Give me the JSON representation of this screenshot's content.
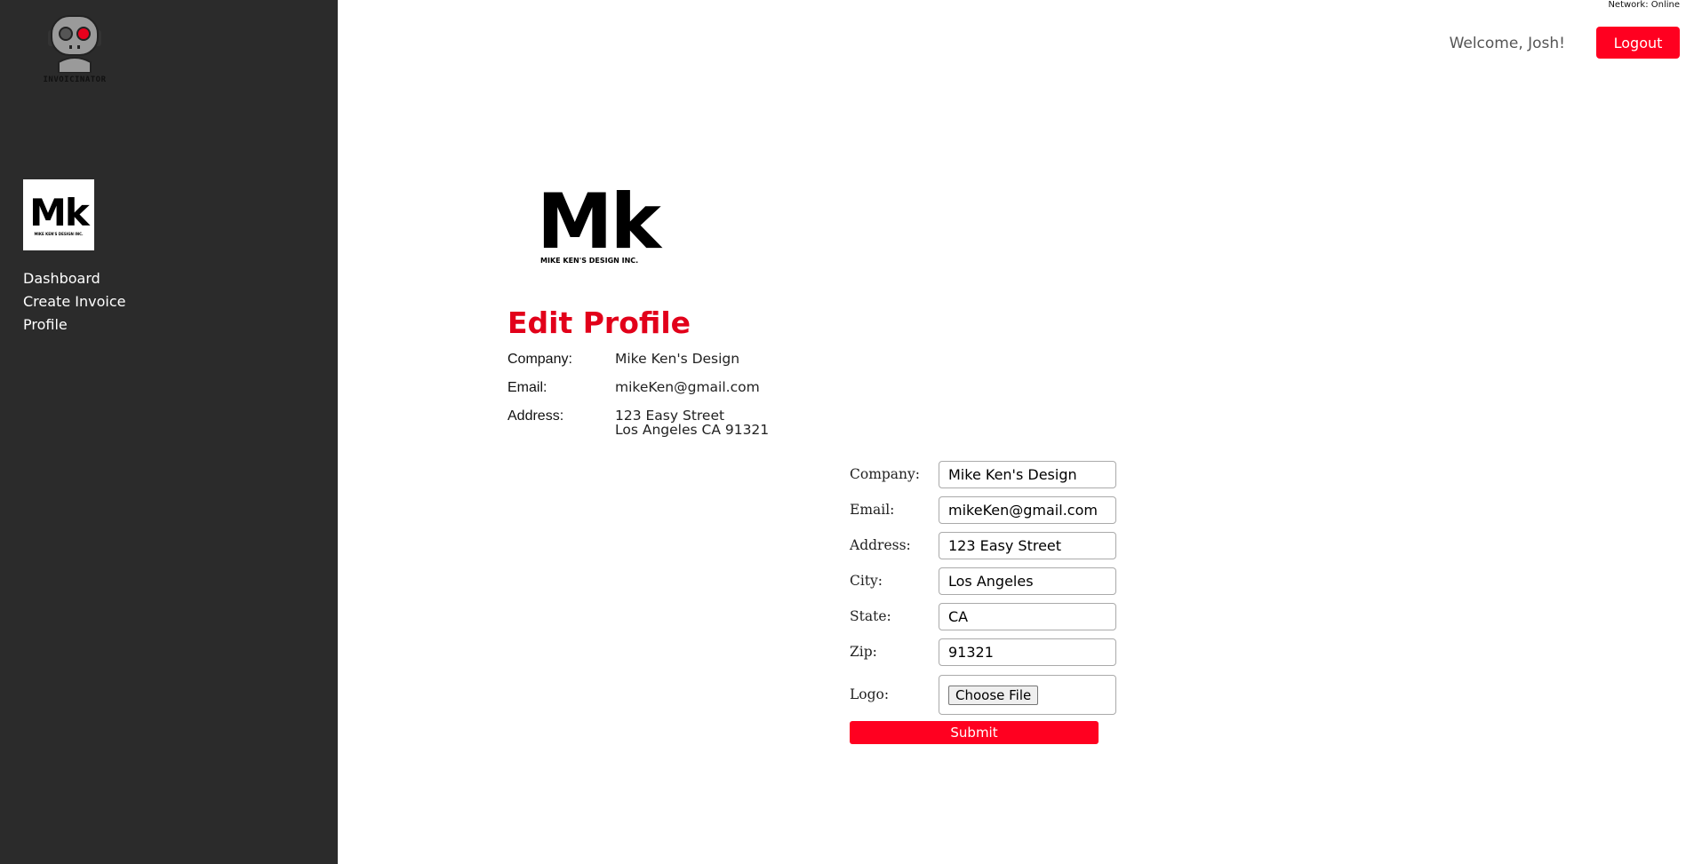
{
  "app": {
    "name": "INVOICINATOR"
  },
  "header": {
    "network_status": "Network: Online",
    "welcome": "Welcome, Josh!",
    "logout_label": "Logout"
  },
  "company_logo": {
    "initials": "Mk",
    "tagline": "MIKE KEN'S DESIGN INC."
  },
  "sidebar": {
    "items": [
      {
        "label": "Dashboard"
      },
      {
        "label": "Create Invoice"
      },
      {
        "label": "Profile"
      }
    ]
  },
  "profile": {
    "title": "Edit Profile",
    "company_label": "Company:",
    "company": "Mike Ken's Design",
    "email_label": "Email:",
    "email": "mikeKen@gmail.com",
    "address_label": "Address:",
    "address_line1": "123 Easy Street",
    "address_line2": "Los Angeles CA 91321"
  },
  "form": {
    "company_label": "Company:",
    "company_value": "Mike Ken's Design",
    "email_label": "Email:",
    "email_value": "mikeKen@gmail.com",
    "address_label": "Address:",
    "address_value": "123 Easy Street",
    "city_label": "City:",
    "city_value": "Los Angeles",
    "state_label": "State:",
    "state_value": "CA",
    "zip_label": "Zip:",
    "zip_value": "91321",
    "logo_label": "Logo:",
    "choose_file_label": "Choose File",
    "submit_label": "Submit"
  },
  "colors": {
    "accent": "#ff0020",
    "title_red": "#e2001a",
    "sidebar_bg": "#2b2b2b"
  },
  "icons": {
    "app_logo": "robot-icon"
  }
}
